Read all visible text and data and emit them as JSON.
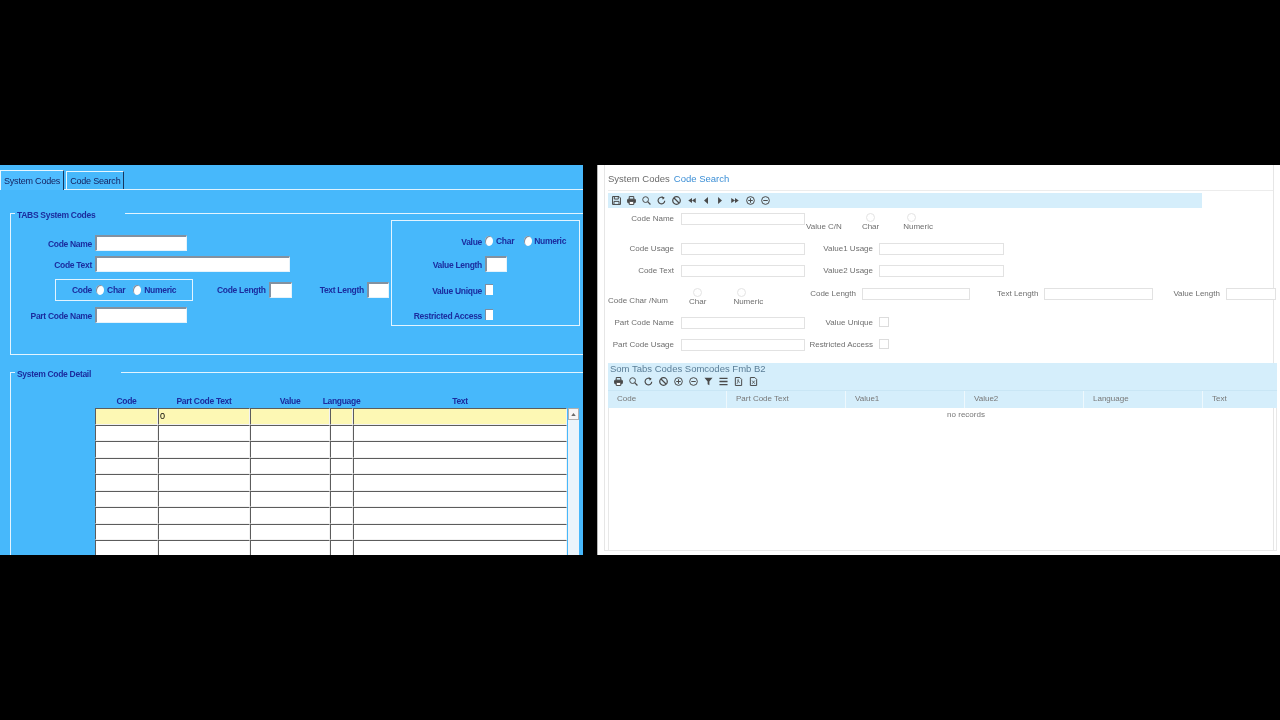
{
  "left_form": {
    "tabs": [
      {
        "label": "System Codes",
        "selected": true
      },
      {
        "label": "Code Search",
        "selected": false
      }
    ],
    "header_group": {
      "title": "TABS System Codes",
      "code_name": {
        "label": "Code Name"
      },
      "code_text": {
        "label": "Code Text"
      },
      "code_type": {
        "label": "Code",
        "options": [
          {
            "label": "Char",
            "selected": false
          },
          {
            "label": "Numeric",
            "selected": false
          }
        ]
      },
      "code_length": {
        "label": "Code Length"
      },
      "text_length": {
        "label": "Text Length"
      },
      "part_code_name": {
        "label": "Part Code Name"
      },
      "value_type": {
        "label": "Value",
        "options": [
          {
            "label": "Char",
            "selected": false
          },
          {
            "label": "Numeric",
            "selected": false
          }
        ]
      },
      "value_length": {
        "label": "Value Length"
      },
      "value_unique": {
        "label": "Value Unique",
        "checked": false
      },
      "restricted_access": {
        "label": "Restricted Access",
        "checked": false
      }
    },
    "detail_group": {
      "title": "System Code Detail",
      "columns": [
        "Code",
        "Part Code Text",
        "Value",
        "Language",
        "Text"
      ],
      "rows": [
        {
          "selected": true,
          "cells": [
            null,
            "0",
            null,
            null,
            null
          ]
        },
        {
          "selected": false
        },
        {
          "selected": false
        },
        {
          "selected": false
        },
        {
          "selected": false
        },
        {
          "selected": false
        },
        {
          "selected": false
        },
        {
          "selected": false
        },
        {
          "selected": false
        }
      ]
    }
  },
  "right_form": {
    "tabs": [
      {
        "label": "System Codes",
        "selected": true
      },
      {
        "label": "Code Search",
        "selected": false
      }
    ],
    "fields": {
      "code_name": {
        "label": "Code Name"
      },
      "value_c_n": {
        "label": "Value C/N",
        "options": [
          {
            "label": "Char",
            "selected": false
          },
          {
            "label": "Numeric",
            "selected": false
          }
        ]
      },
      "code_usage": {
        "label": "Code Usage"
      },
      "value1_usage": {
        "label": "Value1 Usage"
      },
      "code_text": {
        "label": "Code Text"
      },
      "value2_usage": {
        "label": "Value2 Usage"
      },
      "code_char_num": {
        "label": "Code Char /Num",
        "options": [
          {
            "label": "Char",
            "selected": false
          },
          {
            "label": "Numeric",
            "selected": false
          }
        ]
      },
      "code_length": {
        "label": "Code Length"
      },
      "text_length": {
        "label": "Text Length"
      },
      "value_length": {
        "label": "Value Length"
      },
      "part_code_name": {
        "label": "Part Code Name"
      },
      "value_unique": {
        "label": "Value Unique",
        "checked": false
      },
      "part_code_usage": {
        "label": "Part Code Usage"
      },
      "restricted_access": {
        "label": "Restricted Access",
        "checked": false
      }
    },
    "grid": {
      "title": "Som Tabs Codes Somcodes Fmb B2",
      "columns": [
        "Code",
        "Part Code Text",
        "Value1",
        "Value2",
        "Language",
        "Text"
      ],
      "empty_message": "no records"
    }
  }
}
